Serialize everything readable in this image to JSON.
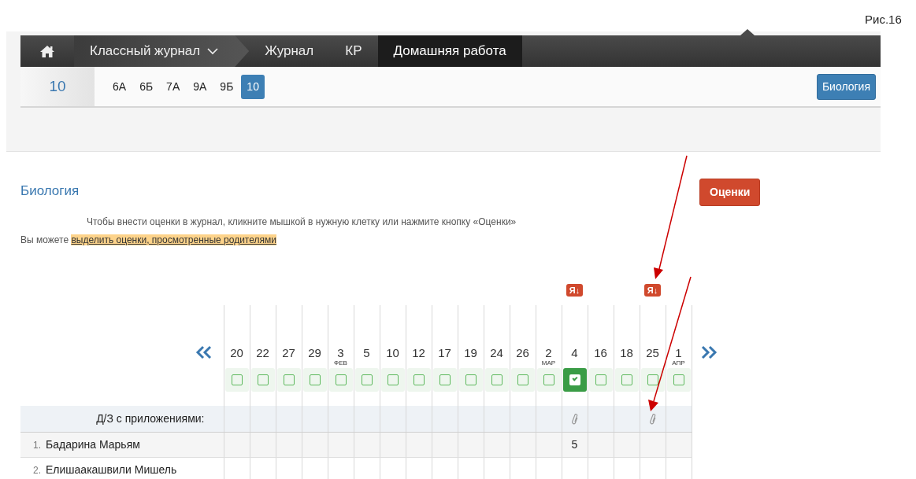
{
  "caption": "Рис.16",
  "nav": {
    "items": [
      {
        "label": "Классный журнал",
        "kind": "dropdown",
        "selected": false
      },
      {
        "label": "Журнал",
        "kind": "link",
        "selected": false
      },
      {
        "label": "КР",
        "kind": "link",
        "selected": false
      },
      {
        "label": "Домашняя работа",
        "kind": "link",
        "selected": true
      }
    ]
  },
  "class_bar": {
    "current": "10",
    "classes": [
      {
        "label": "6А",
        "selected": false
      },
      {
        "label": "6Б",
        "selected": false
      },
      {
        "label": "7А",
        "selected": false
      },
      {
        "label": "9А",
        "selected": false
      },
      {
        "label": "9Б",
        "selected": false
      },
      {
        "label": "10",
        "selected": true
      }
    ],
    "subject_button": "Биология"
  },
  "heading": "Биология",
  "grades_button": "Оценки",
  "hint": "Чтобы внести оценки в журнал, кликните мышкой в нужную клетку или нажмите кнопку «Оценки»",
  "note": {
    "text": "Вы можете",
    "link": "выделить оценки, просмотренные родителями"
  },
  "journal": {
    "dates": [
      {
        "day": "20",
        "checked": false,
        "attachment": false
      },
      {
        "day": "22",
        "checked": false,
        "attachment": false
      },
      {
        "day": "27",
        "checked": false,
        "attachment": false
      },
      {
        "day": "29",
        "checked": false,
        "attachment": false
      },
      {
        "day": "3",
        "month": "ФЕВ",
        "checked": false,
        "attachment": false
      },
      {
        "day": "5",
        "checked": false,
        "attachment": false
      },
      {
        "day": "10",
        "checked": false,
        "attachment": false
      },
      {
        "day": "12",
        "checked": false,
        "attachment": false
      },
      {
        "day": "17",
        "checked": false,
        "attachment": false
      },
      {
        "day": "19",
        "checked": false,
        "attachment": false
      },
      {
        "day": "24",
        "checked": false,
        "attachment": false
      },
      {
        "day": "26",
        "checked": false,
        "attachment": false
      },
      {
        "day": "2",
        "month": "МАР",
        "checked": false,
        "attachment": false
      },
      {
        "day": "4",
        "badge": "Я↓",
        "checked": true,
        "attachment": true
      },
      {
        "day": "16",
        "checked": false,
        "attachment": false
      },
      {
        "day": "18",
        "checked": false,
        "attachment": false
      },
      {
        "day": "25",
        "badge": "Я↓",
        "checked": false,
        "attachment": true
      },
      {
        "day": "1",
        "month": "АПР",
        "checked": false,
        "attachment": false
      }
    ],
    "attachments_label": "Д/З с приложениями:",
    "students": [
      {
        "number": "1.",
        "name": "Бадарина Марьям",
        "cells": [
          {
            "kind": "empty"
          },
          {
            "kind": "empty"
          },
          {
            "kind": "empty"
          },
          {
            "kind": "empty"
          },
          {
            "kind": "empty"
          },
          {
            "kind": "empty"
          },
          {
            "kind": "empty"
          },
          {
            "kind": "empty"
          },
          {
            "kind": "empty"
          },
          {
            "kind": "empty"
          },
          {
            "kind": "empty"
          },
          {
            "kind": "empty"
          },
          {
            "kind": "empty"
          },
          {
            "kind": "grade",
            "value": "5"
          },
          {
            "kind": "empty"
          },
          {
            "kind": "empty"
          },
          {
            "kind": "empty"
          },
          {
            "kind": "empty"
          }
        ]
      },
      {
        "number": "2.",
        "name": "Елишаакашвили Мишель",
        "cells": [
          {
            "kind": "empty"
          },
          {
            "kind": "empty"
          },
          {
            "kind": "empty"
          },
          {
            "kind": "empty"
          },
          {
            "kind": "empty"
          },
          {
            "kind": "empty"
          },
          {
            "kind": "empty"
          },
          {
            "kind": "empty"
          },
          {
            "kind": "empty"
          },
          {
            "kind": "empty"
          },
          {
            "kind": "empty"
          },
          {
            "kind": "empty"
          },
          {
            "kind": "empty"
          },
          {
            "kind": "empty"
          },
          {
            "kind": "empty"
          },
          {
            "kind": "empty"
          },
          {
            "kind": "empty"
          },
          {
            "kind": "empty"
          }
        ]
      }
    ]
  }
}
